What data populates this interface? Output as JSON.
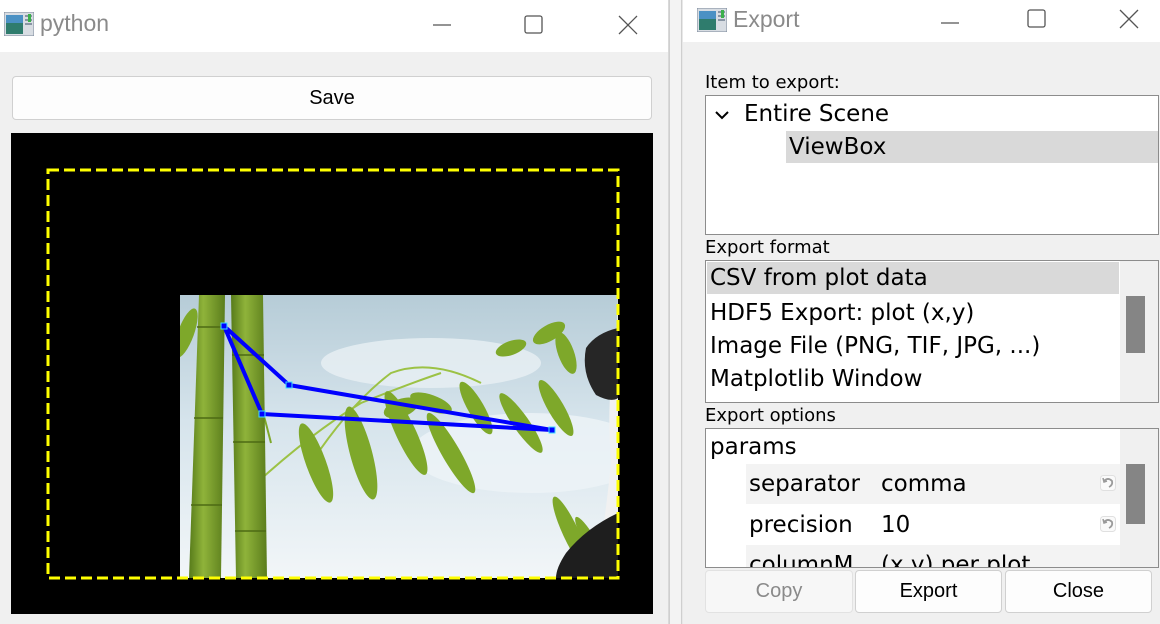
{
  "python_window": {
    "title": "python",
    "app_icon": "qt-app-icon",
    "controls": {
      "minimize": "minimize-icon",
      "maximize": "maximize-icon",
      "close": "close-icon"
    },
    "save_label": "Save",
    "view": {
      "background": "#000000",
      "roi_border_color": "#ffff00",
      "roi_border_style": "dashed",
      "image_content": "bamboo stalks and leaves with panda on sky background",
      "polyline_color": "#0000ff",
      "handle_color": "#00ffff",
      "polyline_closed": true,
      "polyline_handles": 4
    }
  },
  "export_window": {
    "title": "Export",
    "app_icon": "qt-app-icon",
    "controls": {
      "minimize": "minimize-icon",
      "maximize": "maximize-icon",
      "close": "close-icon"
    },
    "item_label": "Item to export:",
    "items": [
      {
        "label": "Entire Scene",
        "expanded": true,
        "selected": false
      },
      {
        "label": "ViewBox",
        "selected": true
      }
    ],
    "format_label": "Export format",
    "formats": [
      {
        "label": "CSV from plot data",
        "selected": true
      },
      {
        "label": "HDF5 Export: plot (x,y)",
        "selected": false
      },
      {
        "label": "Image File (PNG, TIF, JPG, ...)",
        "selected": false
      },
      {
        "label": "Matplotlib Window",
        "selected": false
      }
    ],
    "options_label": "Export options",
    "params_group": "params",
    "params": [
      {
        "name": "separator",
        "value": "comma"
      },
      {
        "name": "precision",
        "value": "10"
      },
      {
        "name": "columnM",
        "value": "(x,y) per plot"
      }
    ],
    "buttons": {
      "copy": "Copy",
      "export": "Export",
      "close": "Close"
    },
    "copy_enabled": false
  }
}
